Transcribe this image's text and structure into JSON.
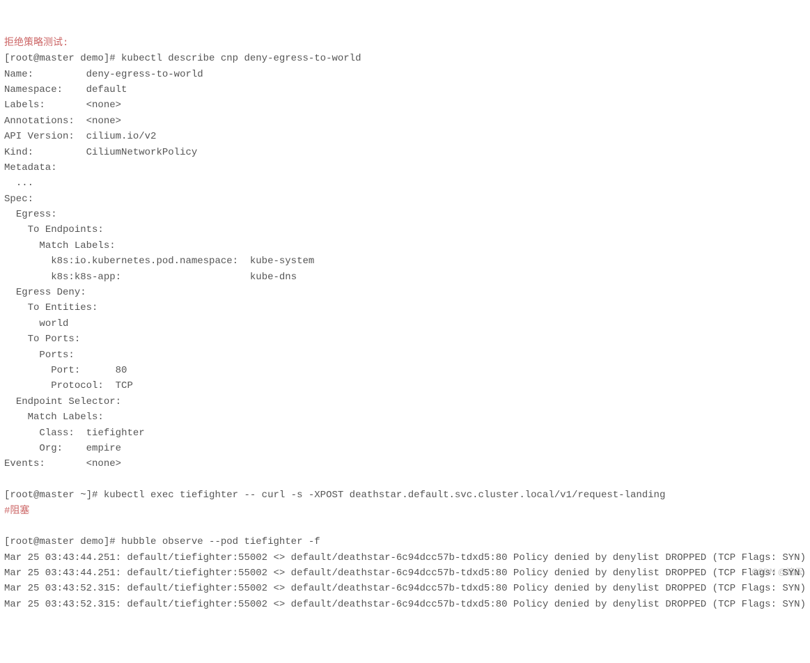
{
  "header_comment": "拒绝策略测试:",
  "describe_cmd": {
    "prompt": "[root@master demo]# ",
    "command": "kubectl describe cnp deny-egress-to-world",
    "fields": {
      "name_label": "Name:",
      "name_value": "deny-egress-to-world",
      "namespace_label": "Namespace:",
      "namespace_value": "default",
      "labels_label": "Labels:",
      "labels_value": "<none>",
      "annotations_label": "Annotations:",
      "annotations_value": "<none>",
      "api_version_label": "API Version:",
      "api_version_value": "cilium.io/v2",
      "kind_label": "Kind:",
      "kind_value": "CiliumNetworkPolicy",
      "metadata_label": "Metadata:",
      "metadata_dots": "...",
      "spec_label": "Spec:",
      "egress_label": "Egress:",
      "to_endpoints_label": "To Endpoints:",
      "match_labels_label": "Match Labels:",
      "ml_ns_key": "k8s:io.kubernetes.pod.namespace:",
      "ml_ns_val": "kube-system",
      "ml_app_key": "k8s:k8s-app:",
      "ml_app_val": "kube-dns",
      "egress_deny_label": "Egress Deny:",
      "to_entities_label": "To Entities:",
      "to_entities_val": "world",
      "to_ports_label": "To Ports:",
      "ports_label": "Ports:",
      "port_label": "Port:",
      "port_val": "80",
      "protocol_label": "Protocol:",
      "protocol_val": "TCP",
      "endpoint_selector_label": "Endpoint Selector:",
      "es_match_labels_label": "Match Labels:",
      "class_label": "Class:",
      "class_val": "tiefighter",
      "org_label": "Org:",
      "org_val": "empire",
      "events_label": "Events:",
      "events_value": "<none>"
    }
  },
  "exec_cmd": {
    "prompt": "[root@master ~]# ",
    "command": "kubectl exec tiefighter -- curl -s -XPOST deathstar.default.svc.cluster.local/v1/request-landing"
  },
  "block_comment": "#阻塞",
  "observe_cmd": {
    "prompt": "[root@master demo]# ",
    "command": "hubble observe --pod tiefighter -f"
  },
  "log_lines": [
    "Mar 25 03:43:44.251: default/tiefighter:55002 <> default/deathstar-6c94dcc57b-tdxd5:80 Policy denied by denylist DROPPED (TCP Flags: SYN)",
    "Mar 25 03:43:44.251: default/tiefighter:55002 <> default/deathstar-6c94dcc57b-tdxd5:80 Policy denied by denylist DROPPED (TCP Flags: SYN)",
    "Mar 25 03:43:52.315: default/tiefighter:55002 <> default/deathstar-6c94dcc57b-tdxd5:80 Policy denied by denylist DROPPED (TCP Flags: SYN)",
    "Mar 25 03:43:52.315: default/tiefighter:55002 <> default/deathstar-6c94dcc57b-tdxd5:80 Policy denied by denylist DROPPED (TCP Flags: SYN)"
  ],
  "watermark": "CSDN @谙云"
}
